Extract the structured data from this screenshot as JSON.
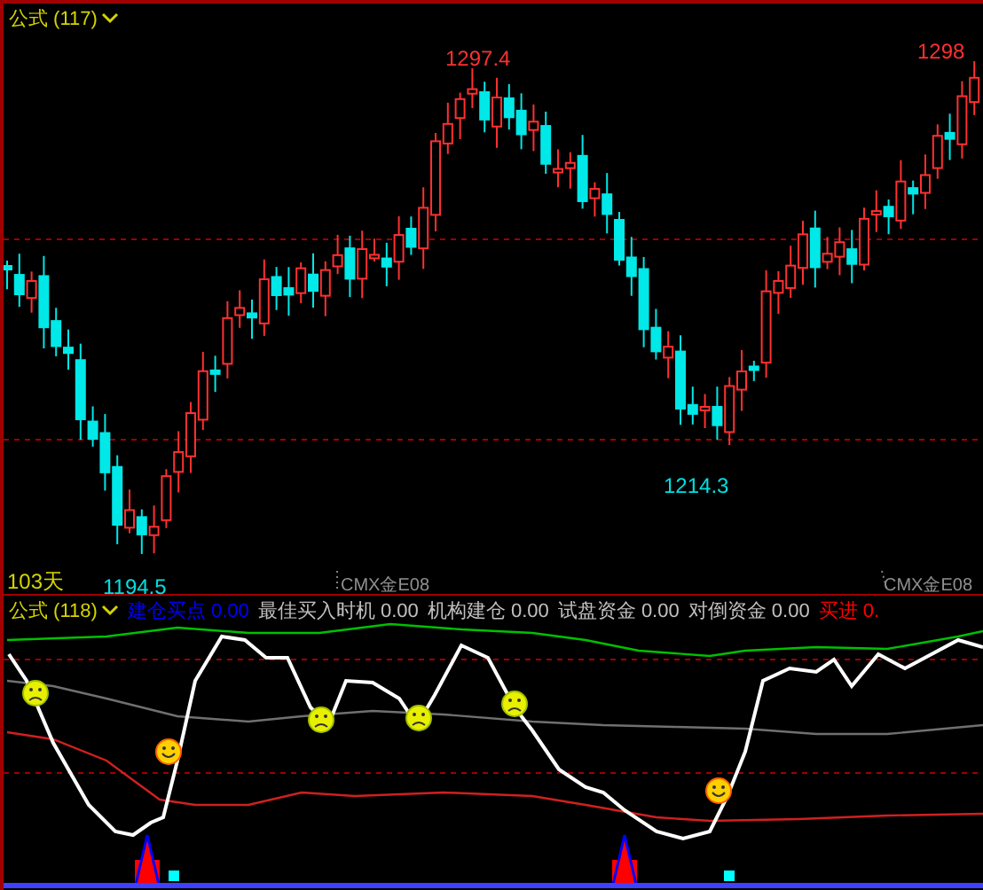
{
  "price_panel": {
    "title": "公式 (117)",
    "labels": [
      {
        "text": "1297.4",
        "kind": "high"
      },
      {
        "text": "1298",
        "kind": "high"
      },
      {
        "text": "1214.3",
        "kind": "low"
      },
      {
        "text": "1194.5",
        "kind": "low"
      }
    ],
    "period": "103天",
    "contract_labels": [
      "CMX金E08",
      "CMX金E08"
    ]
  },
  "indicator_panel": {
    "title": "公式 (118)",
    "legend": [
      {
        "label": "建仓买点",
        "value": "0.00",
        "color": "#0000ff"
      },
      {
        "label": "最佳买入时机",
        "value": "0.00",
        "color": "#c0c0c0"
      },
      {
        "label": "机构建仓",
        "value": "0.00",
        "color": "#c0c0c0"
      },
      {
        "label": "试盘资金",
        "value": "0.00",
        "color": "#c0c0c0"
      },
      {
        "label": "对倒资金",
        "value": "0.00",
        "color": "#c0c0c0"
      },
      {
        "label": "买进",
        "value": "0.",
        "color": "#ff0000"
      }
    ]
  }
}
